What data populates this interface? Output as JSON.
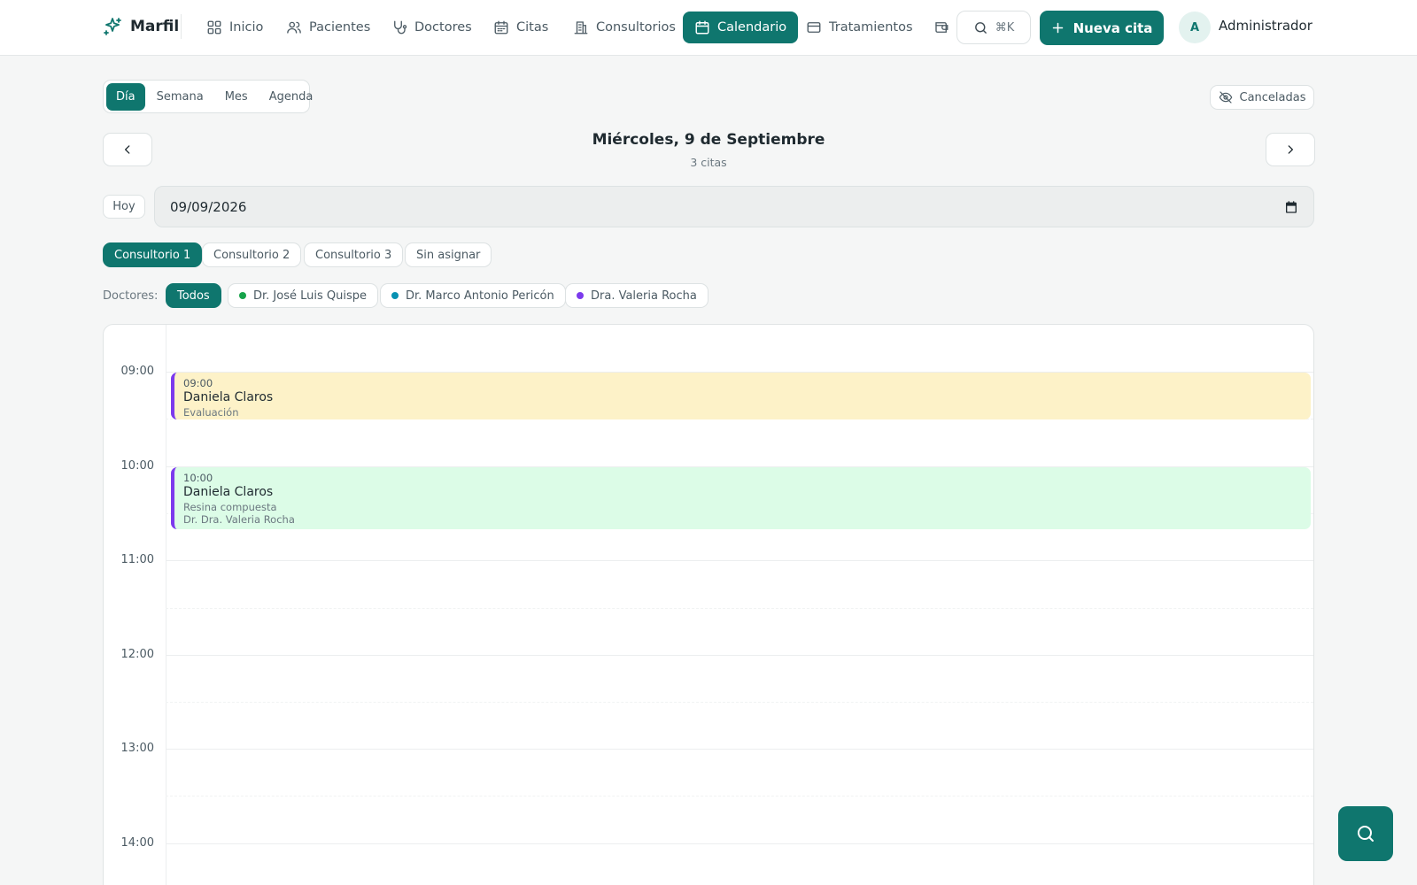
{
  "brand": {
    "name": "Marfil"
  },
  "nav": {
    "items": [
      {
        "label": "Inicio",
        "icon": "grid-icon"
      },
      {
        "label": "Pacientes",
        "icon": "users-icon"
      },
      {
        "label": "Doctores",
        "icon": "stethoscope-icon"
      },
      {
        "label": "Citas",
        "icon": "calendar-icon"
      },
      {
        "label": "Consultorios",
        "icon": "building-icon"
      },
      {
        "label": "Calendario",
        "icon": "calendar-icon",
        "active": true
      },
      {
        "label": "Tratamientos",
        "icon": "card-icon"
      }
    ],
    "search_shortcut": "⌘K",
    "new_button": "Nueva cita",
    "user_initial": "A",
    "user_name": "Administrador"
  },
  "views": {
    "tabs": [
      "Día",
      "Semana",
      "Mes",
      "Agenda"
    ],
    "active": "Día",
    "cancel_toggle": "Canceladas"
  },
  "date_header": {
    "title": "Miércoles, 9 de Septiembre",
    "subtitle": "3 citas"
  },
  "date_picker": {
    "today_label": "Hoy",
    "value": "09/09/2026"
  },
  "rooms": {
    "items": [
      "Consultorio 1",
      "Consultorio 2",
      "Consultorio 3",
      "Sin asignar"
    ],
    "active": "Consultorio 1"
  },
  "doctors": {
    "label": "Doctores:",
    "all_label": "Todos",
    "items": [
      {
        "name": "Dr. José Luis Quispe",
        "color": "#16a34a"
      },
      {
        "name": "Dr. Marco Antonio Pericón",
        "color": "#0891b2"
      },
      {
        "name": "Dra. Valeria Rocha",
        "color": "#7c3aed"
      }
    ]
  },
  "calendar": {
    "hours": [
      "09:00",
      "10:00",
      "11:00",
      "12:00",
      "13:00",
      "14:00"
    ],
    "events": [
      {
        "time": "09:00",
        "patient": "Daniela Claros",
        "treatment": "Evaluación",
        "doctor": "",
        "bg": "#fdf2c8",
        "accent": "#7c3aed"
      },
      {
        "time": "10:00",
        "patient": "Daniela Claros",
        "treatment": "Resina compuesta",
        "doctor": "Dr. Dra. Valeria Rocha",
        "bg": "#dcfce7",
        "accent": "#7c3aed"
      }
    ]
  },
  "colors": {
    "primary": "#0f766e"
  }
}
